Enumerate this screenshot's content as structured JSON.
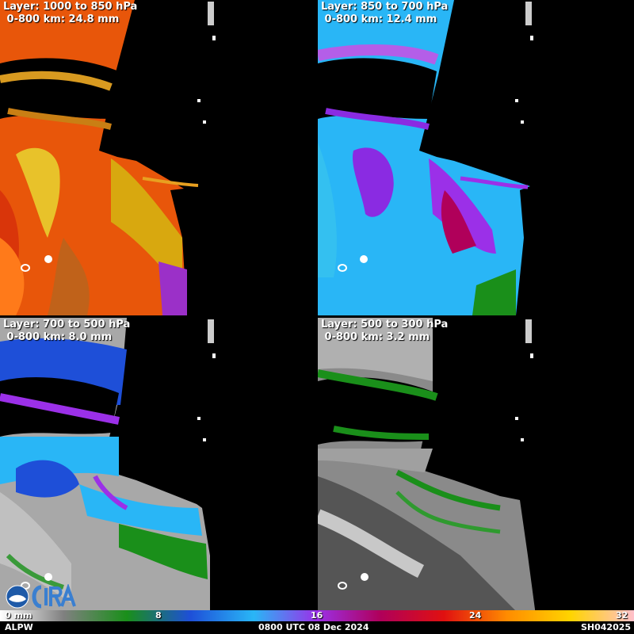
{
  "panels": [
    {
      "layer": "Layer: 1000 to 850 hPa",
      "stat": " 0-800 km: 24.8 mm"
    },
    {
      "layer": "Layer: 850 to 700 hPa",
      "stat": " 0-800 km: 12.4 mm"
    },
    {
      "layer": "Layer: 700 to 500 hPa",
      "stat": " 0-800 km: 8.0 mm"
    },
    {
      "layer": "Layer: 500 to 300 hPa",
      "stat": " 0-800 km: 3.2 mm"
    }
  ],
  "colorbar": {
    "ticks": [
      "0 mm",
      "8",
      "16",
      "24",
      "32"
    ],
    "colors": [
      "#ffffff",
      "#808080",
      "#1a8f1a",
      "#1e4fd8",
      "#29b6f6",
      "#9b30e8",
      "#b0005a",
      "#e01010",
      "#ff8c00",
      "#ffd400",
      "#ffc0cb"
    ]
  },
  "footer": {
    "product": "ALPW",
    "time": "0800 UTC 08 Dec 2024",
    "id": "SH042025"
  },
  "logo": {
    "text": "CIRA",
    "agency": "NOAA"
  }
}
